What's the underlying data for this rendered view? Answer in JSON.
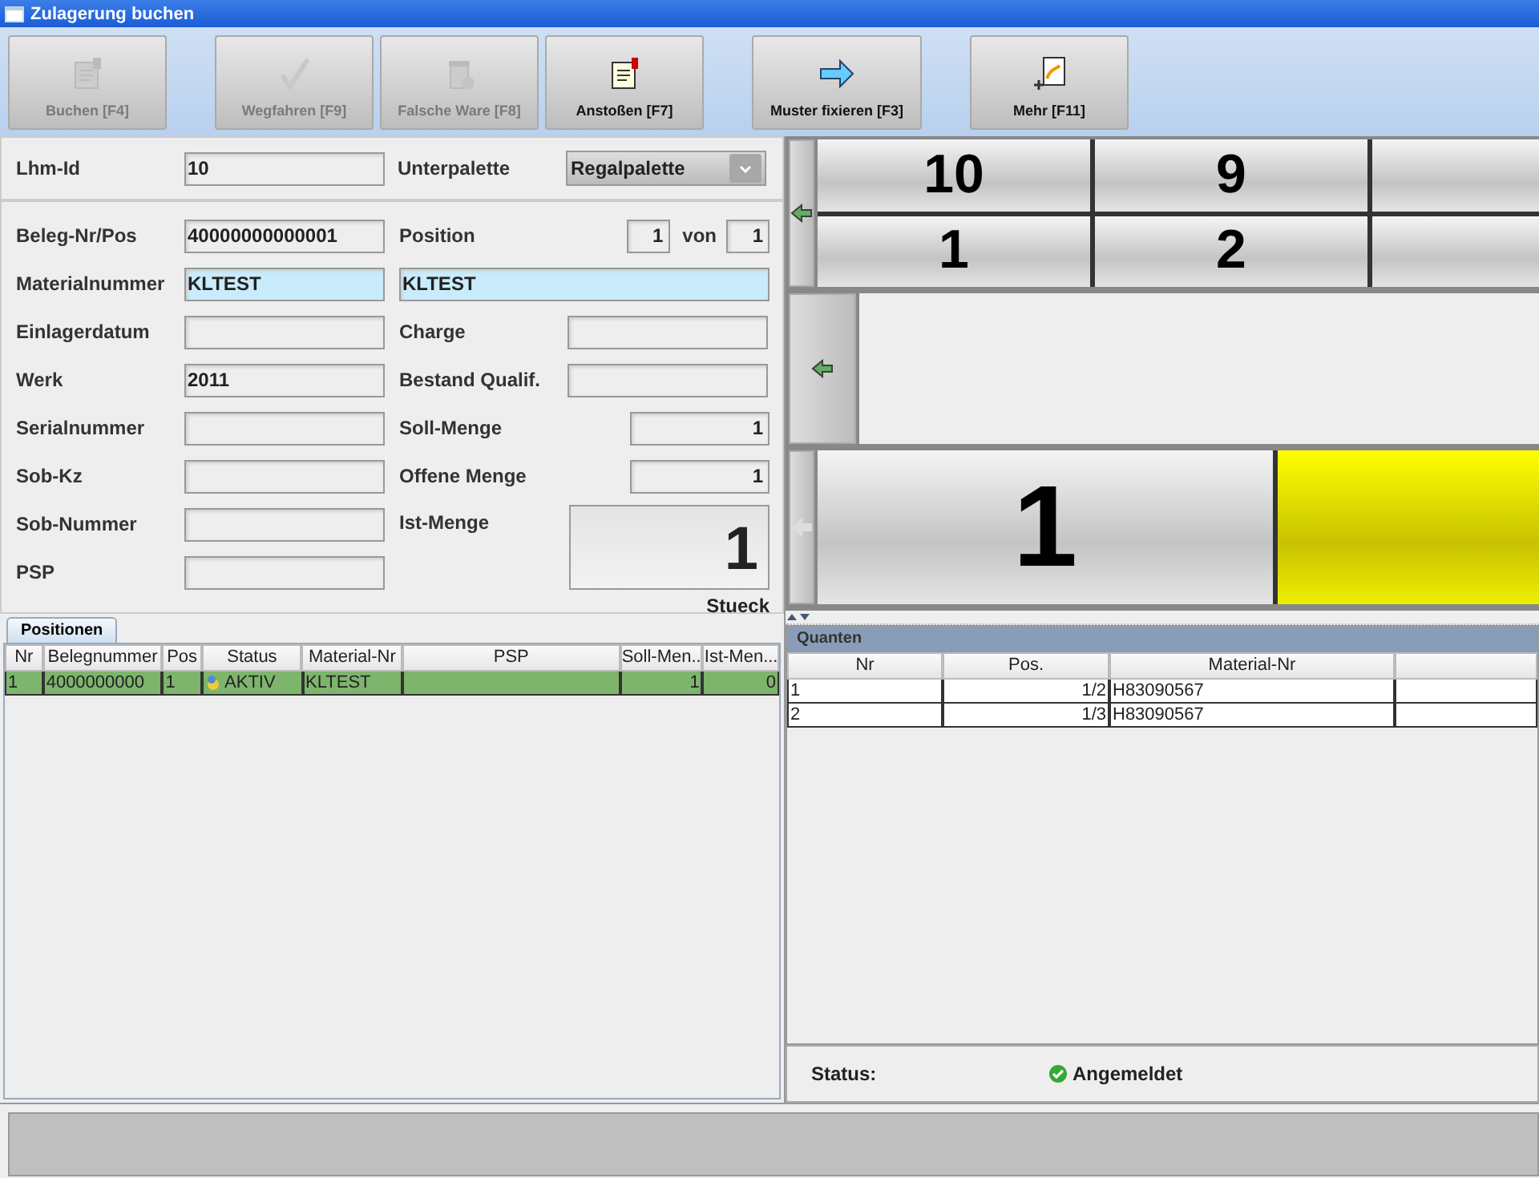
{
  "window": {
    "title": "Zulagerung buchen"
  },
  "toolbar": [
    {
      "label": "Buchen [F4]",
      "disabled": true,
      "kind": "note"
    },
    {
      "label": "Wegfahren [F9]",
      "disabled": true,
      "kind": "check"
    },
    {
      "label": "Falsche Ware [F8]",
      "disabled": true,
      "kind": "bin"
    },
    {
      "label": "Anstoßen [F7]",
      "disabled": false,
      "kind": "flag"
    },
    {
      "label": "Muster fixieren [F3]",
      "disabled": false,
      "kind": "arrow"
    },
    {
      "label": "Mehr [F11]",
      "disabled": false,
      "kind": "more"
    }
  ],
  "header": {
    "lhm_label": "Lhm-Id",
    "lhm_value": "10",
    "unterpalette_label": "Unterpalette",
    "unterpalette_value": "Regalpalette"
  },
  "left_fields": [
    {
      "label": "Beleg-Nr/Pos",
      "value": "40000000000001",
      "highlighted": false
    },
    {
      "label": "Materialnummer",
      "value": "KLTEST",
      "highlighted": true
    },
    {
      "label": "Einlagerdatum",
      "highlighted": false
    },
    {
      "label": "Werk",
      "value": "2011",
      "highlighted": false
    },
    {
      "label": "Serialnummer",
      "highlighted": false
    },
    {
      "label": "Sob-Kz",
      "highlighted": false
    },
    {
      "label": "Sob-Nummer",
      "highlighted": false
    },
    {
      "label": "PSP",
      "highlighted": false
    }
  ],
  "right_fields": [
    {
      "kind": "range",
      "label": "Position",
      "value": "1",
      "separator": "von",
      "total": "1"
    },
    {
      "kind": "wide",
      "value": "KLTEST",
      "highlighted": true
    },
    {
      "kind": "text",
      "label": "Charge"
    },
    {
      "kind": "text",
      "label": "Bestand Qualif."
    },
    {
      "kind": "number",
      "label": "Soll-Menge",
      "value": "1"
    },
    {
      "kind": "number",
      "label": "Offene Menge",
      "value": "1"
    },
    {
      "kind": "big",
      "label": "Ist-Menge",
      "value": "1",
      "unit": "Stueck"
    }
  ],
  "slots": [
    {
      "arrow_disabled": false,
      "rows": [
        [
          {
            "label": "10",
            "selected": false
          },
          {
            "label": "9",
            "selected": false
          },
          {
            "selected": false
          }
        ],
        [
          {
            "label": "1",
            "selected": false
          },
          {
            "label": "2",
            "selected": false
          },
          {
            "selected": false
          }
        ]
      ]
    },
    {
      "arrow_disabled": false
    },
    {
      "arrow_disabled": true,
      "rows": [
        [
          {
            "label": "1",
            "selected": false
          },
          {
            "selected": true
          }
        ]
      ]
    }
  ],
  "positions": {
    "tab": "Positionen",
    "columns": [
      "Nr",
      "Belegnummer",
      "Pos",
      "Status",
      "Material-Nr",
      "PSP",
      "Soll-Men...",
      "Ist-Men..."
    ],
    "rows": [
      {
        "selected": true,
        "cells": [
          "1",
          "4000000000",
          "1",
          "AKTIV",
          "KLTEST",
          "",
          "1",
          "0"
        ]
      }
    ]
  },
  "quanten": {
    "title": "Quanten",
    "columns": [
      "Nr",
      "Pos.",
      "Material-Nr"
    ],
    "rows": [
      [
        "1",
        "1/2",
        "H83090567"
      ],
      [
        "2",
        "1/3",
        "H83090567"
      ]
    ]
  },
  "status": {
    "label": "Status:",
    "value": "Angemeldet"
  }
}
